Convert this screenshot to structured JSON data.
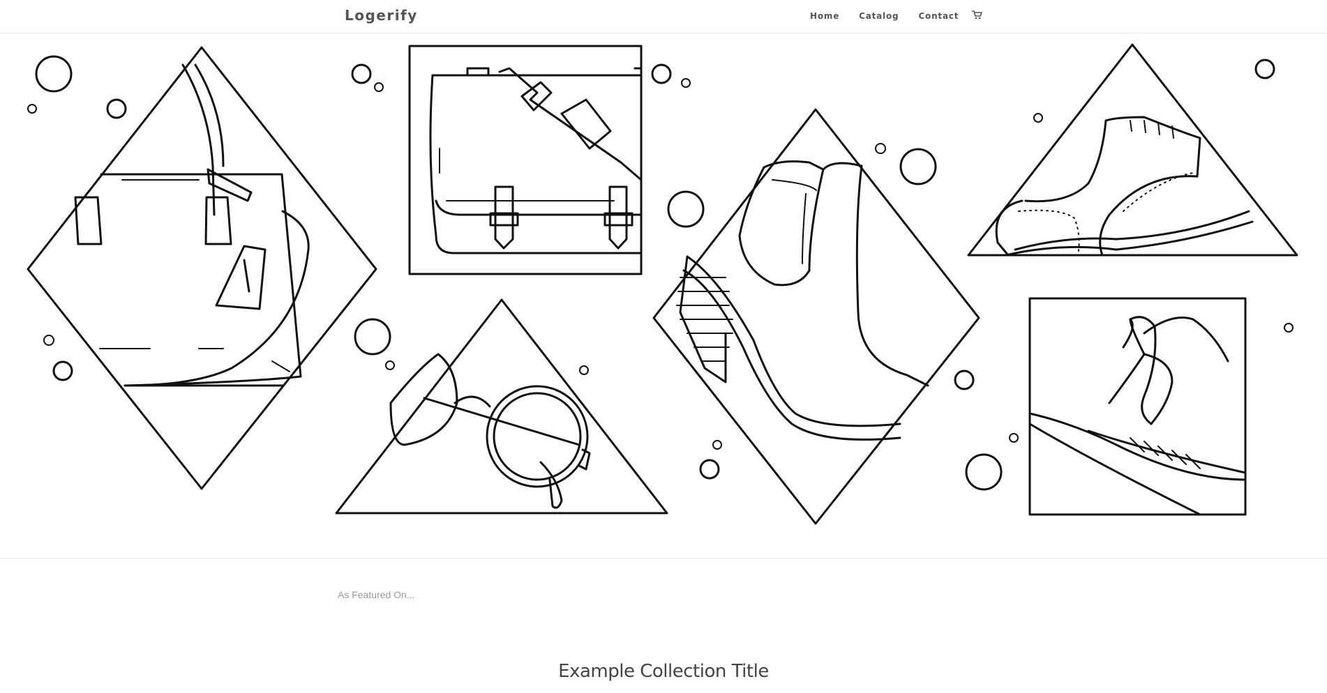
{
  "header": {
    "logo": "Logerify",
    "nav": [
      {
        "label": "Home"
      },
      {
        "label": "Catalog"
      },
      {
        "label": "Contact"
      }
    ],
    "cart_icon": "cart-icon"
  },
  "hero": {
    "illustrations": [
      "handbag",
      "messenger-bag",
      "boot",
      "brogue-shoe",
      "glasses",
      "feather-hat"
    ]
  },
  "featured": {
    "label": "As Featured On..."
  },
  "collection": {
    "title": "Example Collection Title"
  },
  "colors": {
    "background": "#ffffff",
    "line": "#111111",
    "nav_text": "#555555"
  }
}
